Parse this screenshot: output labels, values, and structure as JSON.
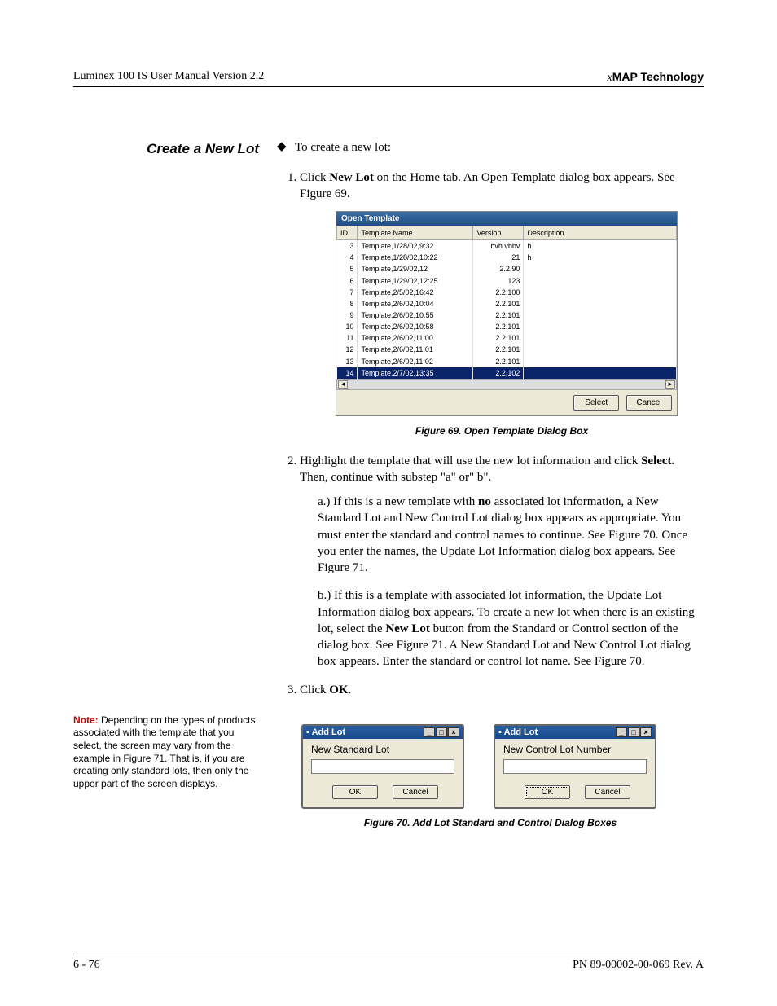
{
  "header": {
    "left": "Luminex 100 IS User Manual Version 2.2",
    "right_x": "x",
    "right_brand": "MAP Technology"
  },
  "side_heading": "Create a New Lot",
  "intro_line": "To create a new lot:",
  "step1_prefix": "Click ",
  "step1_bold": "New Lot",
  "step1_suffix": " on the Home tab. An Open Template dialog box appears. See Figure 69.",
  "dlg1": {
    "title": "Open Template",
    "cols": {
      "id": "ID",
      "name": "Template Name",
      "version": "Version",
      "desc": "Description"
    },
    "rows": [
      {
        "id": "3",
        "name": "Template,1/28/02,9:32",
        "version": "bvh vbbv",
        "desc": "h"
      },
      {
        "id": "4",
        "name": "Template,1/28/02,10:22",
        "version": "21",
        "desc": "h"
      },
      {
        "id": "5",
        "name": "Template,1/29/02,12",
        "version": "2.2.90",
        "desc": ""
      },
      {
        "id": "6",
        "name": "Template,1/29/02,12:25",
        "version": "123",
        "desc": ""
      },
      {
        "id": "7",
        "name": "Template,2/5/02,16:42",
        "version": "2.2.100",
        "desc": ""
      },
      {
        "id": "8",
        "name": "Template,2/6/02,10:04",
        "version": "2.2.101",
        "desc": ""
      },
      {
        "id": "9",
        "name": "Template,2/6/02,10:55",
        "version": "2.2.101",
        "desc": ""
      },
      {
        "id": "10",
        "name": "Template,2/6/02,10:58",
        "version": "2.2.101",
        "desc": ""
      },
      {
        "id": "11",
        "name": "Template,2/6/02,11:00",
        "version": "2.2.101",
        "desc": ""
      },
      {
        "id": "12",
        "name": "Template,2/6/02,11:01",
        "version": "2.2.101",
        "desc": ""
      },
      {
        "id": "13",
        "name": "Template,2/6/02,11:02",
        "version": "2.2.101",
        "desc": ""
      },
      {
        "id": "14",
        "name": "Template,2/7/02,13:35",
        "version": "2.2.102",
        "desc": ""
      }
    ],
    "select": "Select",
    "cancel": "Cancel"
  },
  "fig69": "Figure 69.  Open Template Dialog Box",
  "step2_prefix": "Highlight the template that will use the new lot information and click ",
  "step2_bold": "Select.",
  "step2_suffix": " Then, continue with substep \"a\" or\" b\".",
  "sub_a_pre": "a.) If this is a new template with ",
  "sub_a_bold": "no",
  "sub_a_post": " associated lot information, a New Standard Lot and New Control Lot dialog box appears as appropriate. You must enter the standard and control names to continue. See Figure 70. Once you enter the names, the Update Lot Information dialog box appears. See Figure 71.",
  "sub_b_pre": "b.) If this is a template with associated lot information, the Update Lot Information dialog box appears. To create a new lot when there is an existing lot, select the ",
  "sub_b_bold": "New Lot",
  "sub_b_post": " button from the Standard or Control section of the dialog box. See Figure 71. A New Standard Lot and New Control Lot dialog box appears. Enter the standard or control lot name. See Figure 70.",
  "step3_prefix": "Click ",
  "step3_bold": "OK",
  "step3_suffix": ".",
  "note_label": "Note:",
  "note_body": "  Depending on the types of products associated with the template that you select, the screen may vary from the example in Figure 71. That is, if you are creating only standard lots, then only the upper part of the screen displays.",
  "addlot": {
    "title": "Add Lot",
    "std_label": "New Standard Lot",
    "ctl_label": "New Control Lot Number",
    "ok": "OK",
    "cancel": "Cancel"
  },
  "fig70": "Figure 70.  Add Lot Standard and Control Dialog Boxes",
  "footer": {
    "left": "6 - 76",
    "right": "PN 89-00002-00-069 Rev. A"
  }
}
